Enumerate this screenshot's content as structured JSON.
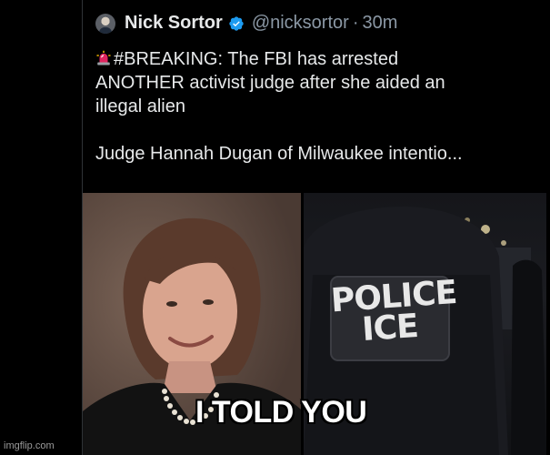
{
  "tweet": {
    "display_name": "Nick Sortor",
    "handle": "@nicksortor",
    "separator": "·",
    "timestamp": "30m",
    "body_lines": [
      "#BREAKING: The FBI has arrested",
      "ANOTHER activist judge after she aided an",
      "illegal alien"
    ],
    "body_line_4": "Judge Hannah Dugan of Milwaukee intentio...",
    "verified_icon": "verified-badge-icon",
    "siren_icon": "rotating-light-icon",
    "verified_color": "#1d9bf0"
  },
  "media": {
    "vest_line_1": "POLICE",
    "vest_line_2": "ICE"
  },
  "meme": {
    "caption": "I TOLD YOU"
  },
  "watermark": "imgflip.com"
}
